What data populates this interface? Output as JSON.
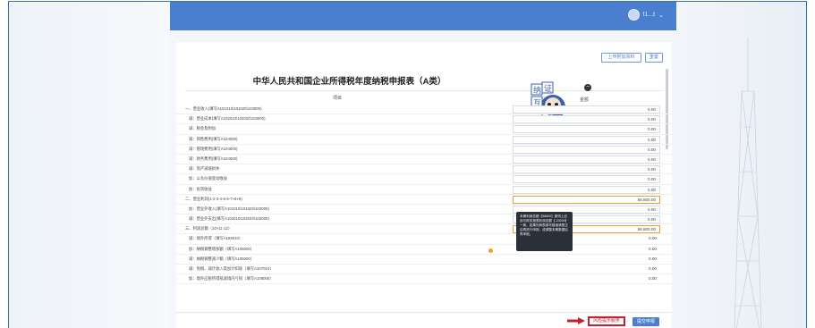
{
  "topbar": {
    "username": "t1...t",
    "dropdown_caret": "⌄"
  },
  "toolbar": {
    "upload_label": "上传附加资料",
    "reset_label": "重置"
  },
  "form": {
    "title": "中华人民共和国企业所得税年度纳税申报表（A类）",
    "col_item": "项目",
    "col_amount": "金额"
  },
  "mascot": {
    "text": "纳证互动"
  },
  "rows": [
    {
      "label": "一、营业收入(填写A101010\\101020\\103000)",
      "value": "0.00"
    },
    {
      "label": "减：营业成本(填写A102010\\102020\\103000)",
      "value": "0.00"
    },
    {
      "label": "减：税金及附加",
      "value": "0.00"
    },
    {
      "label": "减：销售费用(填写A104000)",
      "value": "0.00"
    },
    {
      "label": "减：管理费用(填写A104000)",
      "value": "0.00"
    },
    {
      "label": "减：财务费用(填写A104000)",
      "value": "0.00"
    },
    {
      "label": "减：资产减值损失",
      "value": "0.00"
    },
    {
      "label": "加：公允价值变动收益",
      "value": "0.00"
    },
    {
      "label": "加：投资收益",
      "value": "0.00"
    },
    {
      "label": "二、营业利润(1-2-3-4-5-6-7+8+9)",
      "value": "58,800.00"
    },
    {
      "label": "加：营业外收入(填写A101010\\101020\\103000)",
      "value": "0.00"
    },
    {
      "label": "减：营业外支出(填写A102010\\102020\\103000)",
      "value": "0.00"
    },
    {
      "label": "三、利润总额（10+11-12）",
      "value": "58,800.00"
    },
    {
      "label": "减：境外所得（填写A108010）",
      "value": "0.00"
    },
    {
      "label": "加：纳税调整增加额（填写A105000）",
      "value": "0.00"
    },
    {
      "label": "减：纳税调整减少额（填写A105000）",
      "value": "0.00"
    },
    {
      "label": "减：免税、减计收入及加计扣除（填写A107010）",
      "value": "0.00"
    },
    {
      "label": "加：境外应税所得抵减境内亏损（填写A108000）",
      "value": "0.00"
    }
  ],
  "tooltip": {
    "text": "本期利润总额【58800】原则上应该与财务报表利润总额【-23000】一致，如果利润表填写错误请更正后再进行申报，或调整本期数据后再申报。"
  },
  "footer": {
    "preview_label": "风险提示服务",
    "submit_label": "提交申报"
  }
}
